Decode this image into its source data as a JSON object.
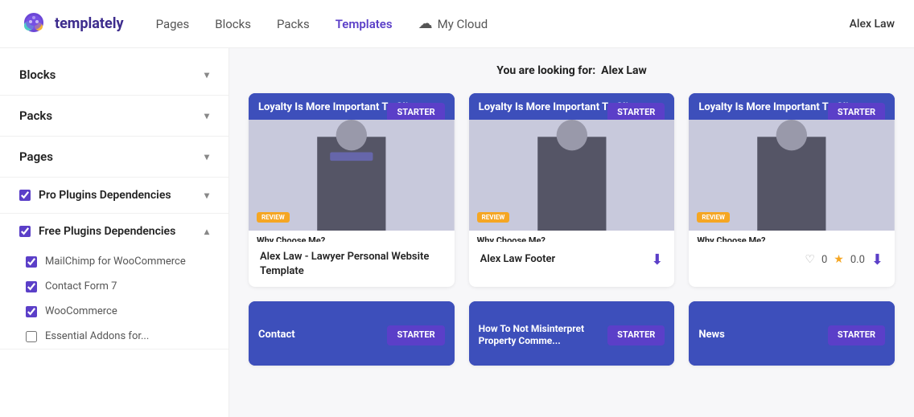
{
  "app": {
    "logo_text": "templately",
    "user_name": "Alex Law"
  },
  "nav": {
    "links": [
      {
        "label": "Pages",
        "active": false
      },
      {
        "label": "Blocks",
        "active": false
      },
      {
        "label": "Packs",
        "active": false
      },
      {
        "label": "Templates",
        "active": true
      },
      {
        "label": "My Cloud",
        "active": false,
        "hasIcon": true
      }
    ]
  },
  "sidebar": {
    "sections": [
      {
        "id": "blocks",
        "label": "Blocks",
        "hasChevron": true,
        "chevronDir": "down"
      },
      {
        "id": "packs",
        "label": "Packs",
        "hasChevron": true,
        "chevronDir": "down"
      },
      {
        "id": "pages",
        "label": "Pages",
        "hasChevron": true,
        "chevronDir": "down"
      }
    ],
    "pro_deps": {
      "label": "Pro Plugins Dependencies",
      "checked": true,
      "chevronDir": "down"
    },
    "free_deps": {
      "label": "Free Plugins Dependencies",
      "checked": true,
      "chevronDir": "up",
      "plugins": [
        {
          "label": "MailChimp for WooCommerce",
          "checked": true
        },
        {
          "label": "Contact Form 7",
          "checked": true
        },
        {
          "label": "WooCommerce",
          "checked": true
        },
        {
          "label": "Essential Addons for...",
          "checked": false
        }
      ]
    }
  },
  "content": {
    "search_label": "You are looking for:",
    "search_term": "Alex Law",
    "cards": [
      {
        "id": "card1",
        "badge": "STARTER",
        "title": "Alex Law - Lawyer Personal Website Template",
        "has_download": false,
        "rating_count": null,
        "rating": null,
        "preview_title": "Loyalty Is More Important To Client"
      },
      {
        "id": "card2",
        "badge": "STARTER",
        "title": "Alex Law Footer",
        "has_download": true,
        "rating_count": null,
        "rating": null,
        "preview_title": "Loyalty Is More Important To Client"
      },
      {
        "id": "card3",
        "badge": "STARTER",
        "title": "",
        "has_download": true,
        "rating_count": "0",
        "rating": "0.0",
        "preview_title": "Loyalty Is More Important To Client"
      }
    ],
    "bottom_cards": [
      {
        "id": "bc1",
        "badge": "STARTER",
        "label": "Contact"
      },
      {
        "id": "bc2",
        "badge": "STARTER",
        "label": "How To Not Misinterpret Property Comme..."
      },
      {
        "id": "bc3",
        "badge": "STARTER",
        "label": "News"
      }
    ]
  },
  "icons": {
    "chevron_down": "▾",
    "chevron_up": "▴",
    "download": "⬇",
    "heart": "♡",
    "star": "★",
    "cloud": "☁"
  }
}
